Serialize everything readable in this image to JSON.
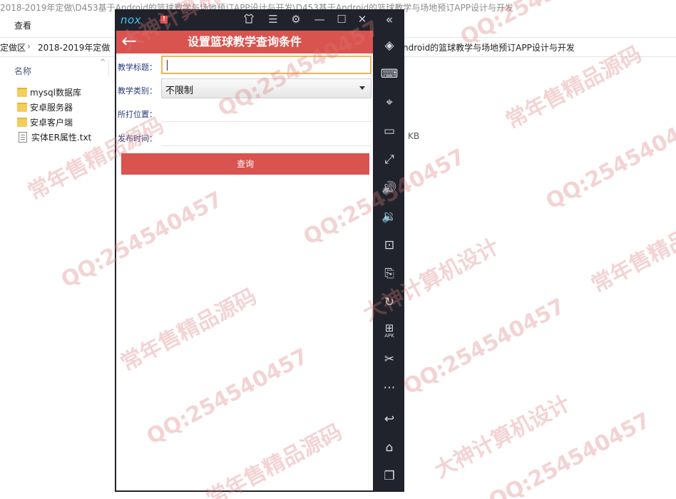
{
  "explorer": {
    "title": "2018-2019年定做\\D453基于Android的篮球教学与场地预订APP设计与开发\\D453基于Android的篮球教学与场地预订APP设计与开发",
    "menu_view": "查看",
    "breadcrumb_left": "定做区",
    "breadcrumb_mid": "2018-2019年定做",
    "breadcrumb_right": "ndroid的篮球教学与场地预订APP设计与开发",
    "column_name": "名称",
    "files": [
      {
        "name": "mysql数据库",
        "type": "folder"
      },
      {
        "name": "安卓服务器",
        "type": "folder"
      },
      {
        "name": "安卓客户端",
        "type": "folder"
      },
      {
        "name": "实体ER属性.txt",
        "type": "text"
      }
    ],
    "size_unit": "KB"
  },
  "emulator": {
    "logo": "nox",
    "badge": "!",
    "top_icons": [
      "shirt-icon",
      "menu-icon",
      "gear-icon",
      "minimize-icon",
      "maximize-icon",
      "close-icon",
      "collapse-icon"
    ],
    "side_icons": [
      "diamond-icon",
      "keyboard-icon",
      "location-icon",
      "screen-icon",
      "fullscreen-icon",
      "volume-up-icon",
      "volume-down-icon",
      "screenshot-icon",
      "multi-instance-icon",
      "sync-icon",
      "apk-icon",
      "scissors-icon",
      "more-icon",
      "back-icon",
      "home-icon",
      "recents-icon"
    ],
    "apk_label": "APK"
  },
  "app": {
    "title": "设置篮球教学查询条件",
    "fields": {
      "title_label": "教学标题：",
      "title_value": "",
      "category_label": "教学类别：",
      "category_value": "不限制",
      "location_label": "所打位置：",
      "location_value": "",
      "time_label": "发布时间：",
      "time_value": ""
    },
    "query_button": "查询",
    "accent_color": "#d9534f"
  },
  "watermark": {
    "qq": "QQ:254540457",
    "brand1": "大神计算机设计",
    "brand2": "常年售精品源码"
  }
}
